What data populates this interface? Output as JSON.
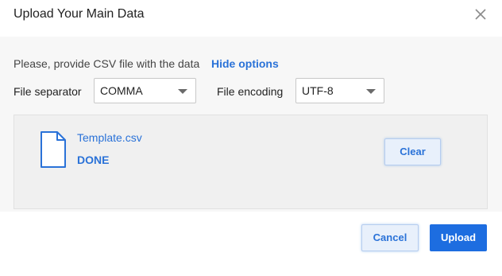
{
  "dialog": {
    "title": "Upload Your Main Data"
  },
  "options": {
    "prompt": "Please, provide CSV file with the data",
    "toggle_label": "Hide options",
    "separator_label": "File separator",
    "separator_value": "COMMA",
    "encoding_label": "File encoding",
    "encoding_value": "UTF-8"
  },
  "file": {
    "name": "Template.csv",
    "status": "DONE",
    "clear_label": "Clear"
  },
  "footer": {
    "cancel_label": "Cancel",
    "upload_label": "Upload"
  },
  "colors": {
    "accent": "#2a72d8",
    "primary_button": "#1d6de0",
    "body_background": "#f7f7f7",
    "panel_background": "#f0f0f0"
  },
  "icons": {
    "close": "close-icon",
    "file": "file-icon",
    "dropdown": "chevron-down-icon"
  }
}
